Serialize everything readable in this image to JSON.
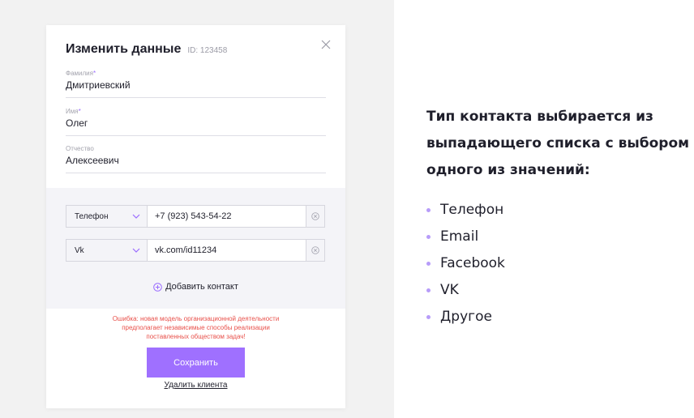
{
  "modal": {
    "title": "Изменить данные",
    "client_id": "ID: 123458",
    "fields": [
      {
        "label": "Фамилия",
        "required": "*",
        "value": "Дмитриевский"
      },
      {
        "label": "Имя",
        "required": "*",
        "value": "Олег"
      },
      {
        "label": "Отчество",
        "required": "",
        "value": "Алексеевич"
      }
    ],
    "contacts": [
      {
        "type": "Телефон",
        "value": "+7 (923) 543-54-22"
      },
      {
        "type": "Vk",
        "value": "vk.com/id11234"
      }
    ],
    "add_contact": "Добавить контакт",
    "error": "Ошибка: новая модель организационной деятельности предполагает независимые способы реализации поставленных обществом задач!",
    "save": "Сохранить",
    "delete": "Удалить клиента"
  },
  "info": {
    "heading": "Тип контакта выбирается из выпадающего списка с выбором одного из значений:",
    "options": [
      "Телефон",
      "Email",
      "Facebook",
      "VK",
      "Другое"
    ]
  },
  "colors": {
    "accent": "#9f70ff",
    "error": "#e8504a",
    "bullet": "#b79cf9",
    "panel": "#f4f4f8"
  }
}
